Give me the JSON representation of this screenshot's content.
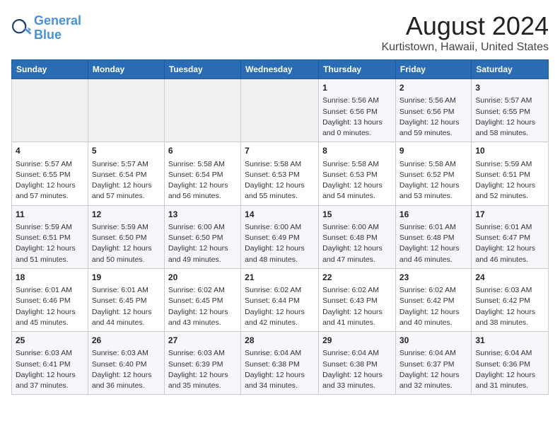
{
  "header": {
    "logo_line1": "General",
    "logo_line2": "Blue",
    "title": "August 2024",
    "subtitle": "Kurtistown, Hawaii, United States"
  },
  "weekdays": [
    "Sunday",
    "Monday",
    "Tuesday",
    "Wednesday",
    "Thursday",
    "Friday",
    "Saturday"
  ],
  "weeks": [
    [
      {
        "day": "",
        "empty": true
      },
      {
        "day": "",
        "empty": true
      },
      {
        "day": "",
        "empty": true
      },
      {
        "day": "",
        "empty": true
      },
      {
        "day": "1",
        "sunrise": "5:56 AM",
        "sunset": "6:56 PM",
        "daylight": "13 hours and 0 minutes."
      },
      {
        "day": "2",
        "sunrise": "5:56 AM",
        "sunset": "6:56 PM",
        "daylight": "12 hours and 59 minutes."
      },
      {
        "day": "3",
        "sunrise": "5:57 AM",
        "sunset": "6:55 PM",
        "daylight": "12 hours and 58 minutes."
      }
    ],
    [
      {
        "day": "4",
        "sunrise": "5:57 AM",
        "sunset": "6:55 PM",
        "daylight": "12 hours and 57 minutes."
      },
      {
        "day": "5",
        "sunrise": "5:57 AM",
        "sunset": "6:54 PM",
        "daylight": "12 hours and 57 minutes."
      },
      {
        "day": "6",
        "sunrise": "5:58 AM",
        "sunset": "6:54 PM",
        "daylight": "12 hours and 56 minutes."
      },
      {
        "day": "7",
        "sunrise": "5:58 AM",
        "sunset": "6:53 PM",
        "daylight": "12 hours and 55 minutes."
      },
      {
        "day": "8",
        "sunrise": "5:58 AM",
        "sunset": "6:53 PM",
        "daylight": "12 hours and 54 minutes."
      },
      {
        "day": "9",
        "sunrise": "5:58 AM",
        "sunset": "6:52 PM",
        "daylight": "12 hours and 53 minutes."
      },
      {
        "day": "10",
        "sunrise": "5:59 AM",
        "sunset": "6:51 PM",
        "daylight": "12 hours and 52 minutes."
      }
    ],
    [
      {
        "day": "11",
        "sunrise": "5:59 AM",
        "sunset": "6:51 PM",
        "daylight": "12 hours and 51 minutes."
      },
      {
        "day": "12",
        "sunrise": "5:59 AM",
        "sunset": "6:50 PM",
        "daylight": "12 hours and 50 minutes."
      },
      {
        "day": "13",
        "sunrise": "6:00 AM",
        "sunset": "6:50 PM",
        "daylight": "12 hours and 49 minutes."
      },
      {
        "day": "14",
        "sunrise": "6:00 AM",
        "sunset": "6:49 PM",
        "daylight": "12 hours and 48 minutes."
      },
      {
        "day": "15",
        "sunrise": "6:00 AM",
        "sunset": "6:48 PM",
        "daylight": "12 hours and 47 minutes."
      },
      {
        "day": "16",
        "sunrise": "6:01 AM",
        "sunset": "6:48 PM",
        "daylight": "12 hours and 46 minutes."
      },
      {
        "day": "17",
        "sunrise": "6:01 AM",
        "sunset": "6:47 PM",
        "daylight": "12 hours and 46 minutes."
      }
    ],
    [
      {
        "day": "18",
        "sunrise": "6:01 AM",
        "sunset": "6:46 PM",
        "daylight": "12 hours and 45 minutes."
      },
      {
        "day": "19",
        "sunrise": "6:01 AM",
        "sunset": "6:45 PM",
        "daylight": "12 hours and 44 minutes."
      },
      {
        "day": "20",
        "sunrise": "6:02 AM",
        "sunset": "6:45 PM",
        "daylight": "12 hours and 43 minutes."
      },
      {
        "day": "21",
        "sunrise": "6:02 AM",
        "sunset": "6:44 PM",
        "daylight": "12 hours and 42 minutes."
      },
      {
        "day": "22",
        "sunrise": "6:02 AM",
        "sunset": "6:43 PM",
        "daylight": "12 hours and 41 minutes."
      },
      {
        "day": "23",
        "sunrise": "6:02 AM",
        "sunset": "6:42 PM",
        "daylight": "12 hours and 40 minutes."
      },
      {
        "day": "24",
        "sunrise": "6:03 AM",
        "sunset": "6:42 PM",
        "daylight": "12 hours and 38 minutes."
      }
    ],
    [
      {
        "day": "25",
        "sunrise": "6:03 AM",
        "sunset": "6:41 PM",
        "daylight": "12 hours and 37 minutes."
      },
      {
        "day": "26",
        "sunrise": "6:03 AM",
        "sunset": "6:40 PM",
        "daylight": "12 hours and 36 minutes."
      },
      {
        "day": "27",
        "sunrise": "6:03 AM",
        "sunset": "6:39 PM",
        "daylight": "12 hours and 35 minutes."
      },
      {
        "day": "28",
        "sunrise": "6:04 AM",
        "sunset": "6:38 PM",
        "daylight": "12 hours and 34 minutes."
      },
      {
        "day": "29",
        "sunrise": "6:04 AM",
        "sunset": "6:38 PM",
        "daylight": "12 hours and 33 minutes."
      },
      {
        "day": "30",
        "sunrise": "6:04 AM",
        "sunset": "6:37 PM",
        "daylight": "12 hours and 32 minutes."
      },
      {
        "day": "31",
        "sunrise": "6:04 AM",
        "sunset": "6:36 PM",
        "daylight": "12 hours and 31 minutes."
      }
    ]
  ]
}
